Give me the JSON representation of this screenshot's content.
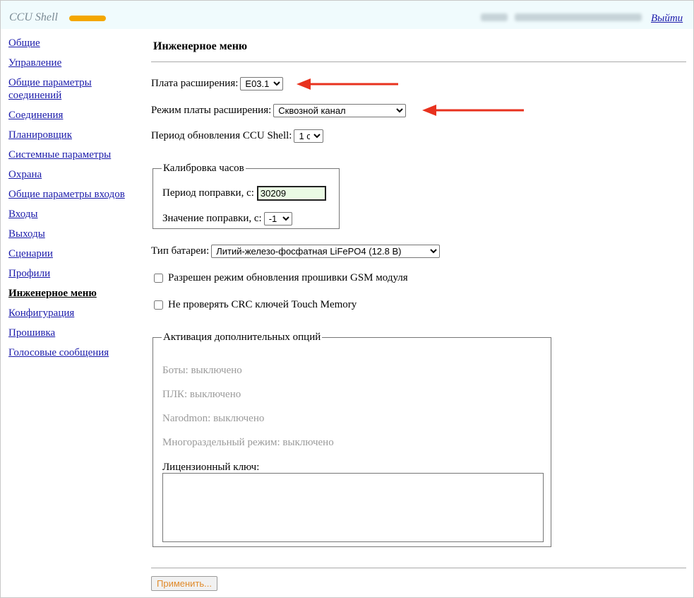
{
  "header": {
    "app_title": "CCU Shell",
    "logout_label": "Выйти"
  },
  "sidebar": {
    "items": [
      {
        "label": "Общие"
      },
      {
        "label": "Управление"
      },
      {
        "label": "Общие параметры соединений"
      },
      {
        "label": "Соединения"
      },
      {
        "label": "Планировщик"
      },
      {
        "label": "Системные параметры"
      },
      {
        "label": "Охрана"
      },
      {
        "label": "Общие параметры входов"
      },
      {
        "label": "Входы"
      },
      {
        "label": "Выходы"
      },
      {
        "label": "Сценарии"
      },
      {
        "label": "Профили"
      },
      {
        "label": "Инженерное меню",
        "active": true
      },
      {
        "label": "Конфигурация"
      },
      {
        "label": "Прошивка"
      },
      {
        "label": "Голосовые сообщения"
      }
    ]
  },
  "main": {
    "title": "Инженерное меню",
    "expansion_board": {
      "label": "Плата расширения:",
      "value": "E03.1"
    },
    "expansion_mode": {
      "label": "Режим платы расширения:",
      "value": "Сквозной канал"
    },
    "refresh_period": {
      "label": "Период обновления CCU Shell:",
      "value": "1 с"
    },
    "clock_calibration": {
      "legend": "Калибровка часов",
      "period_label": "Период поправки, с:",
      "period_value": "30209",
      "correction_label": "Значение поправки, с:",
      "correction_value": "-1"
    },
    "battery": {
      "label": "Тип батареи:",
      "value": "Литий-железо-фосфатная LiFePO4 (12.8 В)"
    },
    "gsm_update": {
      "label": "Разрешен режим обновления прошивки GSM модуля",
      "checked": false
    },
    "no_crc": {
      "label": "Не проверять CRC ключей Touch Memory",
      "checked": false
    },
    "options": {
      "legend": "Активация дополнительных опций",
      "items": [
        "Боты: выключено",
        "ПЛК: выключено",
        "Narodmon: выключено",
        "Многораздельный режим: выключено"
      ],
      "license_label": "Лицензионный ключ:",
      "license_value": ""
    },
    "apply_label": "Применить..."
  },
  "colors": {
    "link": "#1a1aaa",
    "arrow": "#e8321e",
    "topbar_bg": "#f0fbfd",
    "logo_bar": "#f4a700",
    "apply_text": "#e08a2a"
  }
}
